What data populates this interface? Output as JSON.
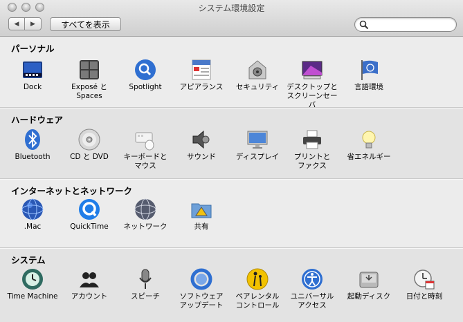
{
  "window": {
    "title": "システム環境設定"
  },
  "toolbar": {
    "back_icon": "back-arrow-icon",
    "forward_icon": "forward-arrow-icon",
    "show_all_label": "すべてを表示",
    "search_placeholder": ""
  },
  "sections": {
    "personal": {
      "title": "パーソナル",
      "items": [
        {
          "label": "Dock",
          "icon": "dock-icon"
        },
        {
          "label": "Exposé と\nSpaces",
          "icon": "expose-icon"
        },
        {
          "label": "Spotlight",
          "icon": "spotlight-icon"
        },
        {
          "label": "アピアランス",
          "icon": "appearance-icon"
        },
        {
          "label": "セキュリティ",
          "icon": "security-icon"
        },
        {
          "label": "デスクトップと\nスクリーンセーバ",
          "icon": "desktop-icon"
        },
        {
          "label": "言語環境",
          "icon": "international-icon"
        }
      ]
    },
    "hardware": {
      "title": "ハードウェア",
      "items": [
        {
          "label": "Bluetooth",
          "icon": "bluetooth-icon"
        },
        {
          "label": "CD と DVD",
          "icon": "cd-dvd-icon"
        },
        {
          "label": "キーボードと\nマウス",
          "icon": "keyboard-mouse-icon"
        },
        {
          "label": "サウンド",
          "icon": "sound-icon"
        },
        {
          "label": "ディスプレイ",
          "icon": "display-icon"
        },
        {
          "label": "プリントと\nファクス",
          "icon": "printer-icon"
        },
        {
          "label": "省エネルギー",
          "icon": "energy-saver-icon"
        }
      ]
    },
    "internet": {
      "title": "インターネットとネットワーク",
      "items": [
        {
          "label": ".Mac",
          "icon": "dotmac-icon"
        },
        {
          "label": "QuickTime",
          "icon": "quicktime-icon"
        },
        {
          "label": "ネットワーク",
          "icon": "network-icon"
        },
        {
          "label": "共有",
          "icon": "sharing-icon"
        }
      ]
    },
    "system": {
      "title": "システム",
      "items": [
        {
          "label": "Time Machine",
          "icon": "time-machine-icon"
        },
        {
          "label": "アカウント",
          "icon": "accounts-icon"
        },
        {
          "label": "スピーチ",
          "icon": "speech-icon"
        },
        {
          "label": "ソフトウェア\nアップデート",
          "icon": "software-update-icon"
        },
        {
          "label": "ペアレンタル\nコントロール",
          "icon": "parental-controls-icon"
        },
        {
          "label": "ユニバーサル\nアクセス",
          "icon": "universal-access-icon"
        },
        {
          "label": "起動ディスク",
          "icon": "startup-disk-icon"
        },
        {
          "label": "日付と時刻",
          "icon": "date-time-icon"
        }
      ]
    }
  },
  "colors": {
    "background": "#ececec",
    "alt_section": "#e3e3e3",
    "accent_blue": "#2f6fd1"
  }
}
